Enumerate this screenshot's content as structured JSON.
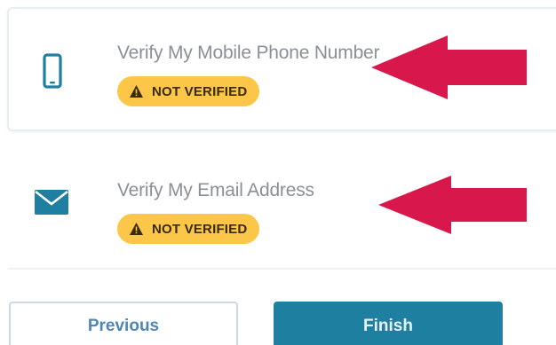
{
  "steps": [
    {
      "title": "Verify My Mobile Phone Number",
      "status": "NOT VERIFIED",
      "icon": "mobile-phone-icon"
    },
    {
      "title": "Verify My Email Address",
      "status": "NOT VERIFIED",
      "icon": "envelope-icon"
    }
  ],
  "buttons": {
    "previous_label": "Previous",
    "finish_label": "Finish"
  },
  "colors": {
    "icon": "#1e7fa1",
    "badge": "#fcc749",
    "arrow": "#d8184c",
    "finish": "#1e7fa1",
    "title_text": "#8a9096"
  }
}
